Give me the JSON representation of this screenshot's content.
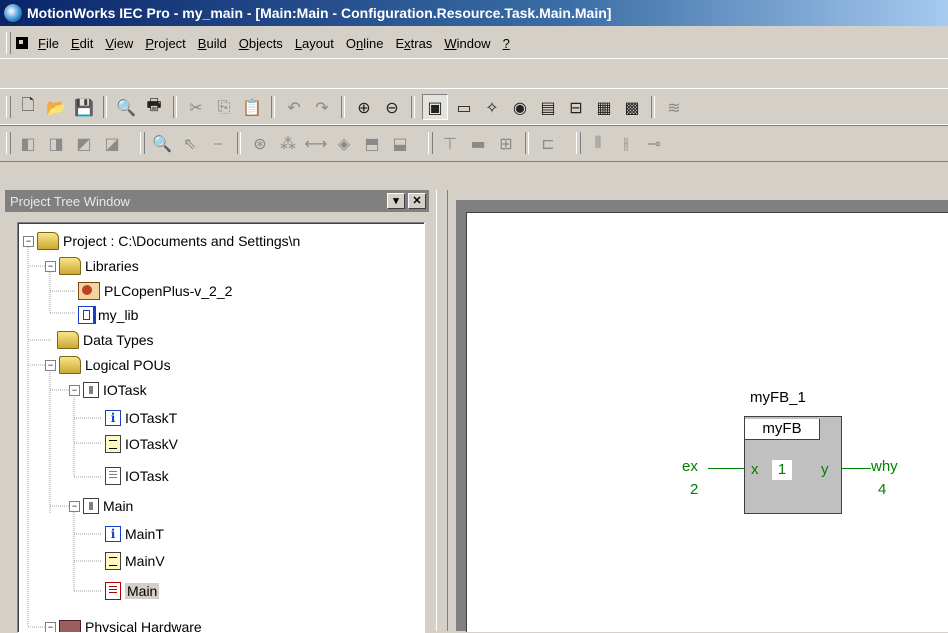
{
  "window": {
    "title": "MotionWorks IEC Pro - my_main - [Main:Main - Configuration.Resource.Task.Main.Main]"
  },
  "menu": [
    {
      "pre": "",
      "ul": "F",
      "post": "ile"
    },
    {
      "pre": "",
      "ul": "E",
      "post": "dit"
    },
    {
      "pre": "",
      "ul": "V",
      "post": "iew"
    },
    {
      "pre": "",
      "ul": "P",
      "post": "roject"
    },
    {
      "pre": "",
      "ul": "B",
      "post": "uild"
    },
    {
      "pre": "",
      "ul": "O",
      "post": "bjects"
    },
    {
      "pre": "",
      "ul": "L",
      "post": "ayout"
    },
    {
      "pre": "O",
      "ul": "n",
      "post": "line"
    },
    {
      "pre": "E",
      "ul": "x",
      "post": "tras"
    },
    {
      "pre": "",
      "ul": "W",
      "post": "indow"
    },
    {
      "pre": "",
      "ul": "?",
      "post": ""
    }
  ],
  "project_tree": {
    "title": "Project Tree Window",
    "items": [
      {
        "label": "Project : C:\\Documents and Settings\\n"
      },
      {
        "label": "Libraries"
      },
      {
        "label": "PLCopenPlus-v_2_2"
      },
      {
        "label": "my_lib"
      },
      {
        "label": "Data Types"
      },
      {
        "label": "Logical POUs"
      },
      {
        "label": "IOTask"
      },
      {
        "label": "IOTaskT"
      },
      {
        "label": "IOTaskV"
      },
      {
        "label": "IOTask"
      },
      {
        "label": "Main"
      },
      {
        "label": "MainT"
      },
      {
        "label": "MainV"
      },
      {
        "label": "Main"
      },
      {
        "label": "Physical Hardware"
      }
    ]
  },
  "diagram": {
    "instance_name": "myFB_1",
    "block_type": "myFB",
    "input_pin": "x",
    "output_pin": "y",
    "input_variable": "ex",
    "input_value": "2",
    "output_variable": "why",
    "output_value": "4",
    "execution_order": "1",
    "wire_color": "#008000"
  }
}
